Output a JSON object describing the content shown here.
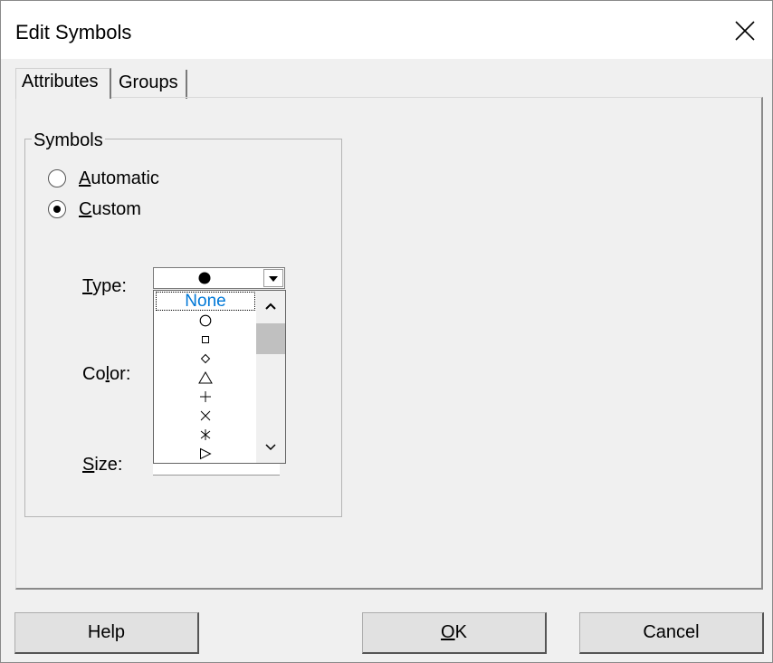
{
  "window": {
    "title": "Edit Symbols"
  },
  "tabs": [
    {
      "label": "Attributes",
      "active": true
    },
    {
      "label": "Groups",
      "active": false
    }
  ],
  "symbols_group": {
    "title": "Symbols",
    "radios": [
      {
        "mnemonic": "A",
        "rest": "utomatic",
        "checked": false
      },
      {
        "mnemonic": "C",
        "rest": "ustom",
        "checked": true
      }
    ]
  },
  "fields": {
    "type": {
      "prefix": "",
      "mnemonic": "T",
      "rest": "ype:"
    },
    "color": {
      "prefix": "Co",
      "mnemonic": "l",
      "rest": "or:"
    },
    "size": {
      "prefix": "",
      "mnemonic": "S",
      "rest": "ize:"
    }
  },
  "type_combo": {
    "selected_icon": "filled-circle-icon",
    "options": [
      {
        "label": "None",
        "icon": null,
        "selected": true
      },
      {
        "label": "",
        "icon": "circle-icon"
      },
      {
        "label": "",
        "icon": "square-icon"
      },
      {
        "label": "",
        "icon": "diamond-icon"
      },
      {
        "label": "",
        "icon": "triangle-icon"
      },
      {
        "label": "",
        "icon": "plus-icon"
      },
      {
        "label": "",
        "icon": "cross-icon"
      },
      {
        "label": "",
        "icon": "asterisk-icon"
      },
      {
        "label": "",
        "icon": "triangle-right-icon"
      }
    ]
  },
  "buttons": {
    "help": "Help",
    "ok_mnemonic": "O",
    "ok_rest": "K",
    "cancel": "Cancel"
  },
  "colors": {
    "selected_text": "#0078d7",
    "window_bg": "#f0f0f0",
    "titlebar_bg": "#ffffff"
  }
}
